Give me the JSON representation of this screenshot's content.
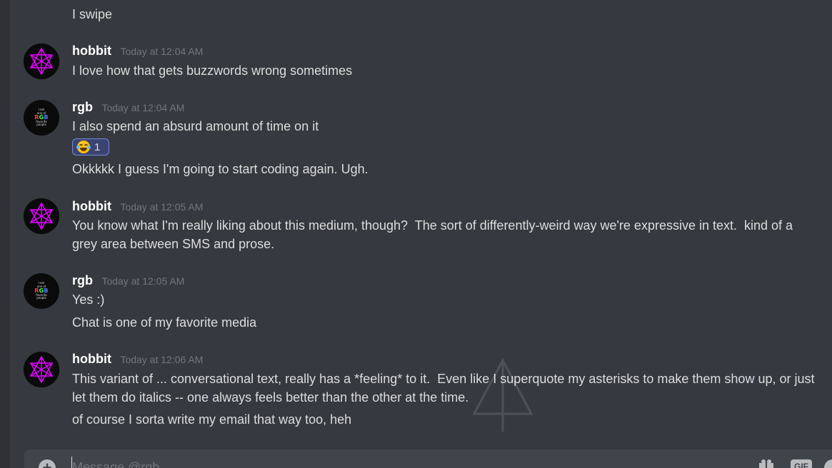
{
  "messages": [
    {
      "type": "continuation",
      "text": "I swipe"
    },
    {
      "type": "group",
      "username": "hobbit",
      "timestamp": "Today at 12:04 AM",
      "avatar": "hobbit",
      "lines": [
        "I love how that gets buzzwords wrong sometimes"
      ]
    },
    {
      "type": "group",
      "username": "rgb",
      "timestamp": "Today at 12:04 AM",
      "avatar": "rgb",
      "lines": [
        "I also spend an absurd amount of time on it",
        "Okkkkk I guess I'm going to start coding again. Ugh."
      ],
      "reaction": {
        "emoji": "joy-emoji",
        "count": "1"
      }
    },
    {
      "type": "group",
      "username": "hobbit",
      "timestamp": "Today at 12:05 AM",
      "avatar": "hobbit",
      "lines": [
        "You know what I'm really liking about this medium, though?  The sort of differently-weird way we're expressive in text.  kind of a grey area between SMS and prose."
      ]
    },
    {
      "type": "group",
      "username": "rgb",
      "timestamp": "Today at 12:05 AM",
      "avatar": "rgb",
      "lines": [
        "Yes :)",
        "Chat is one of my favorite media"
      ]
    },
    {
      "type": "group",
      "username": "hobbit",
      "timestamp": "Today at 12:06 AM",
      "avatar": "hobbit",
      "lines": [
        "This variant of ... conversational text, really has a *feeling* to it.  Even like I superquote my asterisks to make them show up, or just let them do italics -- one always feels better than the other at the time.",
        "of course I sorta write my email that way too, heh"
      ]
    }
  ],
  "rgb_avatar_text": {
    "l1": "I am",
    "l2": "one of",
    "big": "RGB",
    "l3": "favorite",
    "l4": "people"
  },
  "composer": {
    "placeholder": "Message @rgb",
    "gif_label": "GIF"
  },
  "colors": {
    "background": "#36393f",
    "username": "#ffffff",
    "timestamp": "#72767d",
    "text": "#dcddde",
    "avatar_mark": "#e100ff"
  }
}
